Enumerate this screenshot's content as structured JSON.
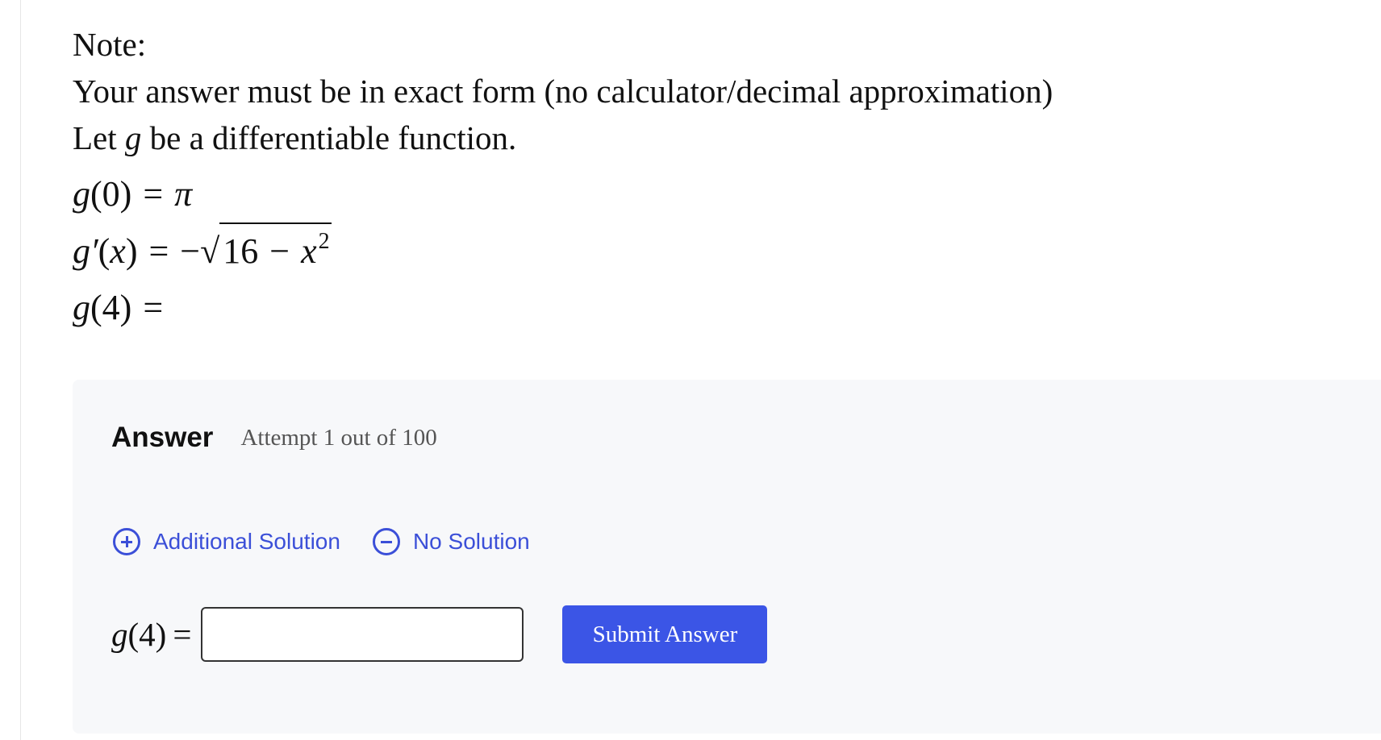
{
  "question": {
    "note_label": "Note:",
    "note_text": "Your answer must be in exact form (no calculator/decimal approximation)",
    "intro_prefix": "Let",
    "intro_var": "g",
    "intro_suffix": "be a differentiable function.",
    "eq1": {
      "fn": "g",
      "arg": "(0)",
      "eq": "=",
      "rhs": "π"
    },
    "eq2": {
      "fn": "g′",
      "arg_open": "(",
      "arg_var": "x",
      "arg_close": ")",
      "eq": "=",
      "neg": "−",
      "radicand_num": "16",
      "minus": "−",
      "radicand_var": "x",
      "exponent": "2"
    },
    "eq3": {
      "fn": "g",
      "arg": "(4)",
      "eq": "="
    }
  },
  "answer": {
    "title": "Answer",
    "attempt": "Attempt 1 out of 100",
    "additional_solution": "Additional Solution",
    "no_solution": "No Solution",
    "label_fn": "g",
    "label_arg": "(4)",
    "label_eq": "=",
    "input_value": "",
    "submit_label": "Submit Answer"
  },
  "colors": {
    "accent": "#3b4fd8",
    "button": "#3b55e6",
    "panel_bg": "#f7f8fa"
  }
}
